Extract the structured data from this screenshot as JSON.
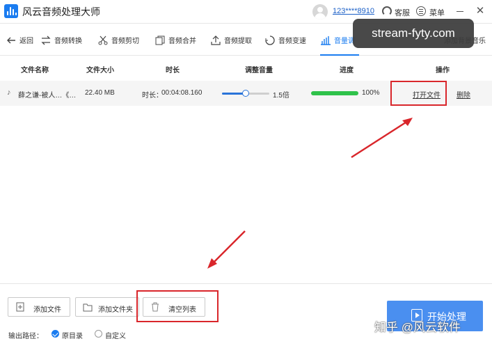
{
  "app": {
    "title": "风云音频处理大师",
    "user_id": "123****8910",
    "service_label": "客服",
    "menu_label": "菜单"
  },
  "toolbar": {
    "back": "返回",
    "items": [
      "音频转换",
      "音频剪切",
      "音频合并",
      "音频提取",
      "音频变速",
      "音量调",
      "",
      "添加背景音乐"
    ]
  },
  "table": {
    "headers": [
      "文件名称",
      "文件大小",
      "时长",
      "调整音量",
      "进度",
      "操作"
    ],
    "rows": [
      {
        "file_name": "薛之谦-被人…《…",
        "file_size": "22.40 MB",
        "duration_label": "时长：",
        "duration": "00:04:08.160",
        "volume": 0.5,
        "volume_label": "1.5倍",
        "progress": 100,
        "progress_label": "100%",
        "open_label": "打开文件",
        "delete_label": "删除"
      }
    ]
  },
  "bottom": {
    "add_file": "添加文件",
    "add_folder": "添加文件夹",
    "clear_list": "清空列表",
    "start": "开始处理",
    "output_label": "输出路径：",
    "option_original": "原目录",
    "option_custom": "自定义"
  },
  "watermarks": {
    "top": "stream-fyty.com",
    "bottom": "知乎 @风云软件"
  },
  "colors": {
    "accent": "#1a7cf0",
    "progress": "#2fc24a",
    "annotation": "#d9262b"
  }
}
